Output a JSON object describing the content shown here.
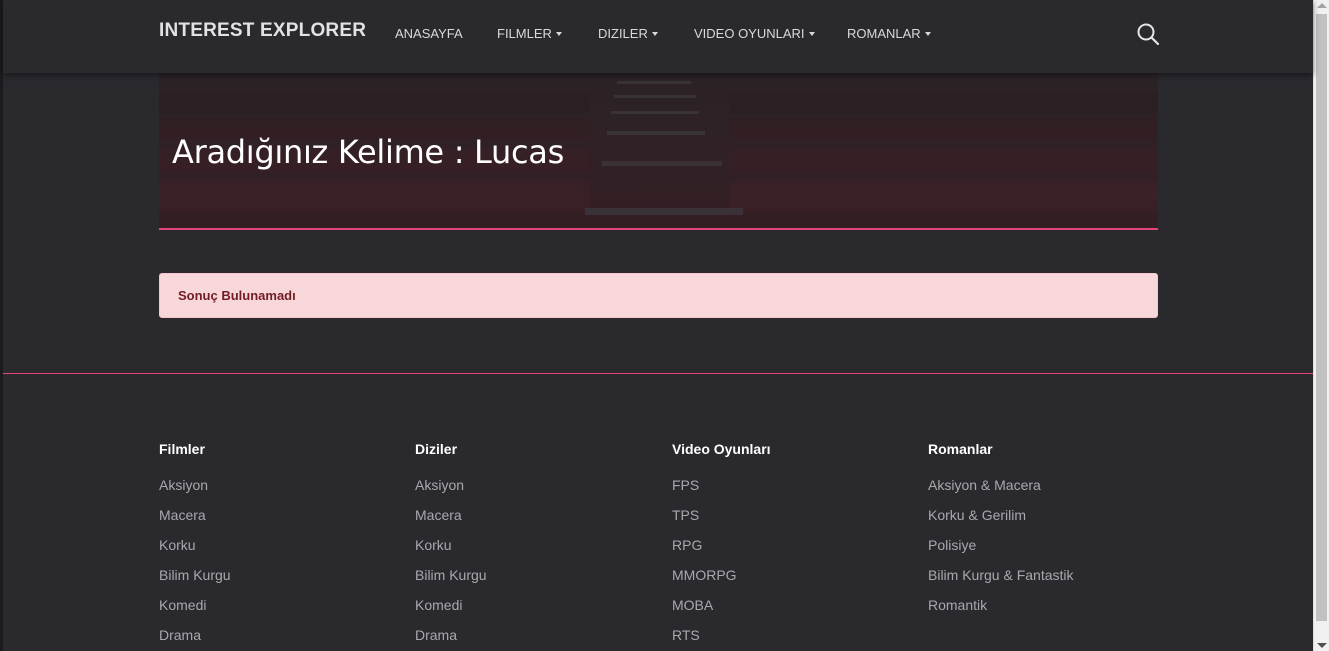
{
  "brand": "INTEREST EXPLORER",
  "nav": {
    "home": "ANASAYFA",
    "films": "FILMLER",
    "series": "DIZILER",
    "games": "VIDEO OYUNLARI",
    "novels": "ROMANLAR"
  },
  "icons": {
    "search": "search-icon"
  },
  "hero": {
    "title": "Aradığınız Kelime : Lucas"
  },
  "alert": {
    "text": "Sonuç Bulunamadı"
  },
  "colors": {
    "accent": "#e5457a",
    "alert_bg": "#f8d7da",
    "alert_text": "#721c24",
    "background": "#2a292e"
  },
  "footer": {
    "columns": [
      {
        "title": "Filmler",
        "links": [
          "Aksiyon",
          "Macera",
          "Korku",
          "Bilim Kurgu",
          "Komedi",
          "Drama"
        ]
      },
      {
        "title": "Diziler",
        "links": [
          "Aksiyon",
          "Macera",
          "Korku",
          "Bilim Kurgu",
          "Komedi",
          "Drama"
        ]
      },
      {
        "title": "Video Oyunları",
        "links": [
          "FPS",
          "TPS",
          "RPG",
          "MMORPG",
          "MOBA",
          "RTS"
        ]
      },
      {
        "title": "Romanlar",
        "links": [
          "Aksiyon & Macera",
          "Korku & Gerilim",
          "Polisiye",
          "Bilim Kurgu & Fantastik",
          "Romantik"
        ]
      }
    ]
  }
}
